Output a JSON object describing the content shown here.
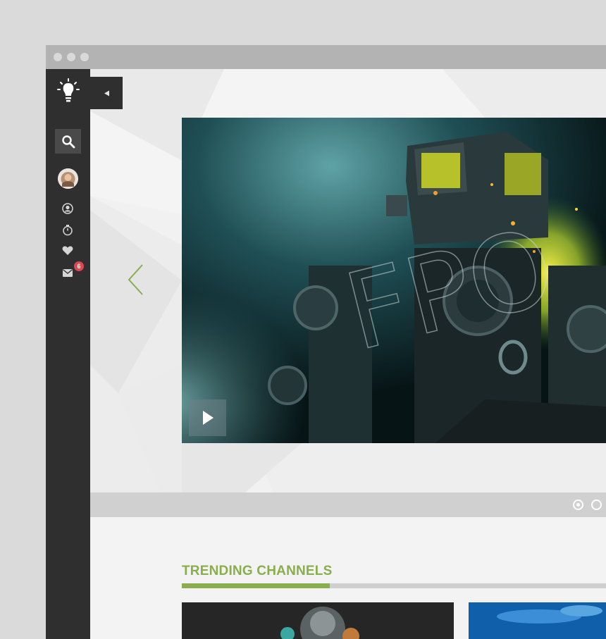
{
  "window": {
    "traffic_lights": [
      "close",
      "minimize",
      "maximize"
    ]
  },
  "sidebar": {
    "logo_icon": "lightbulb-icon",
    "collapse_icon": "triangle-left-icon",
    "items": [
      {
        "name": "search",
        "icon": "search-icon"
      },
      {
        "name": "avatar",
        "icon": "avatar"
      },
      {
        "name": "profile",
        "icon": "user-icon"
      },
      {
        "name": "history",
        "icon": "stopwatch-icon"
      },
      {
        "name": "favorites",
        "icon": "heart-icon"
      },
      {
        "name": "messages",
        "icon": "envelope-icon"
      }
    ],
    "messages_badge": "6"
  },
  "slider": {
    "slide_count": 2,
    "active_slide": 1
  },
  "trending": {
    "title": "TRENDING CHANNELS"
  },
  "colors": {
    "accent": "#8aad4e",
    "sidebar": "#2f2f2f",
    "badge": "#e0474c",
    "titlebar": "#b3b3b3"
  }
}
